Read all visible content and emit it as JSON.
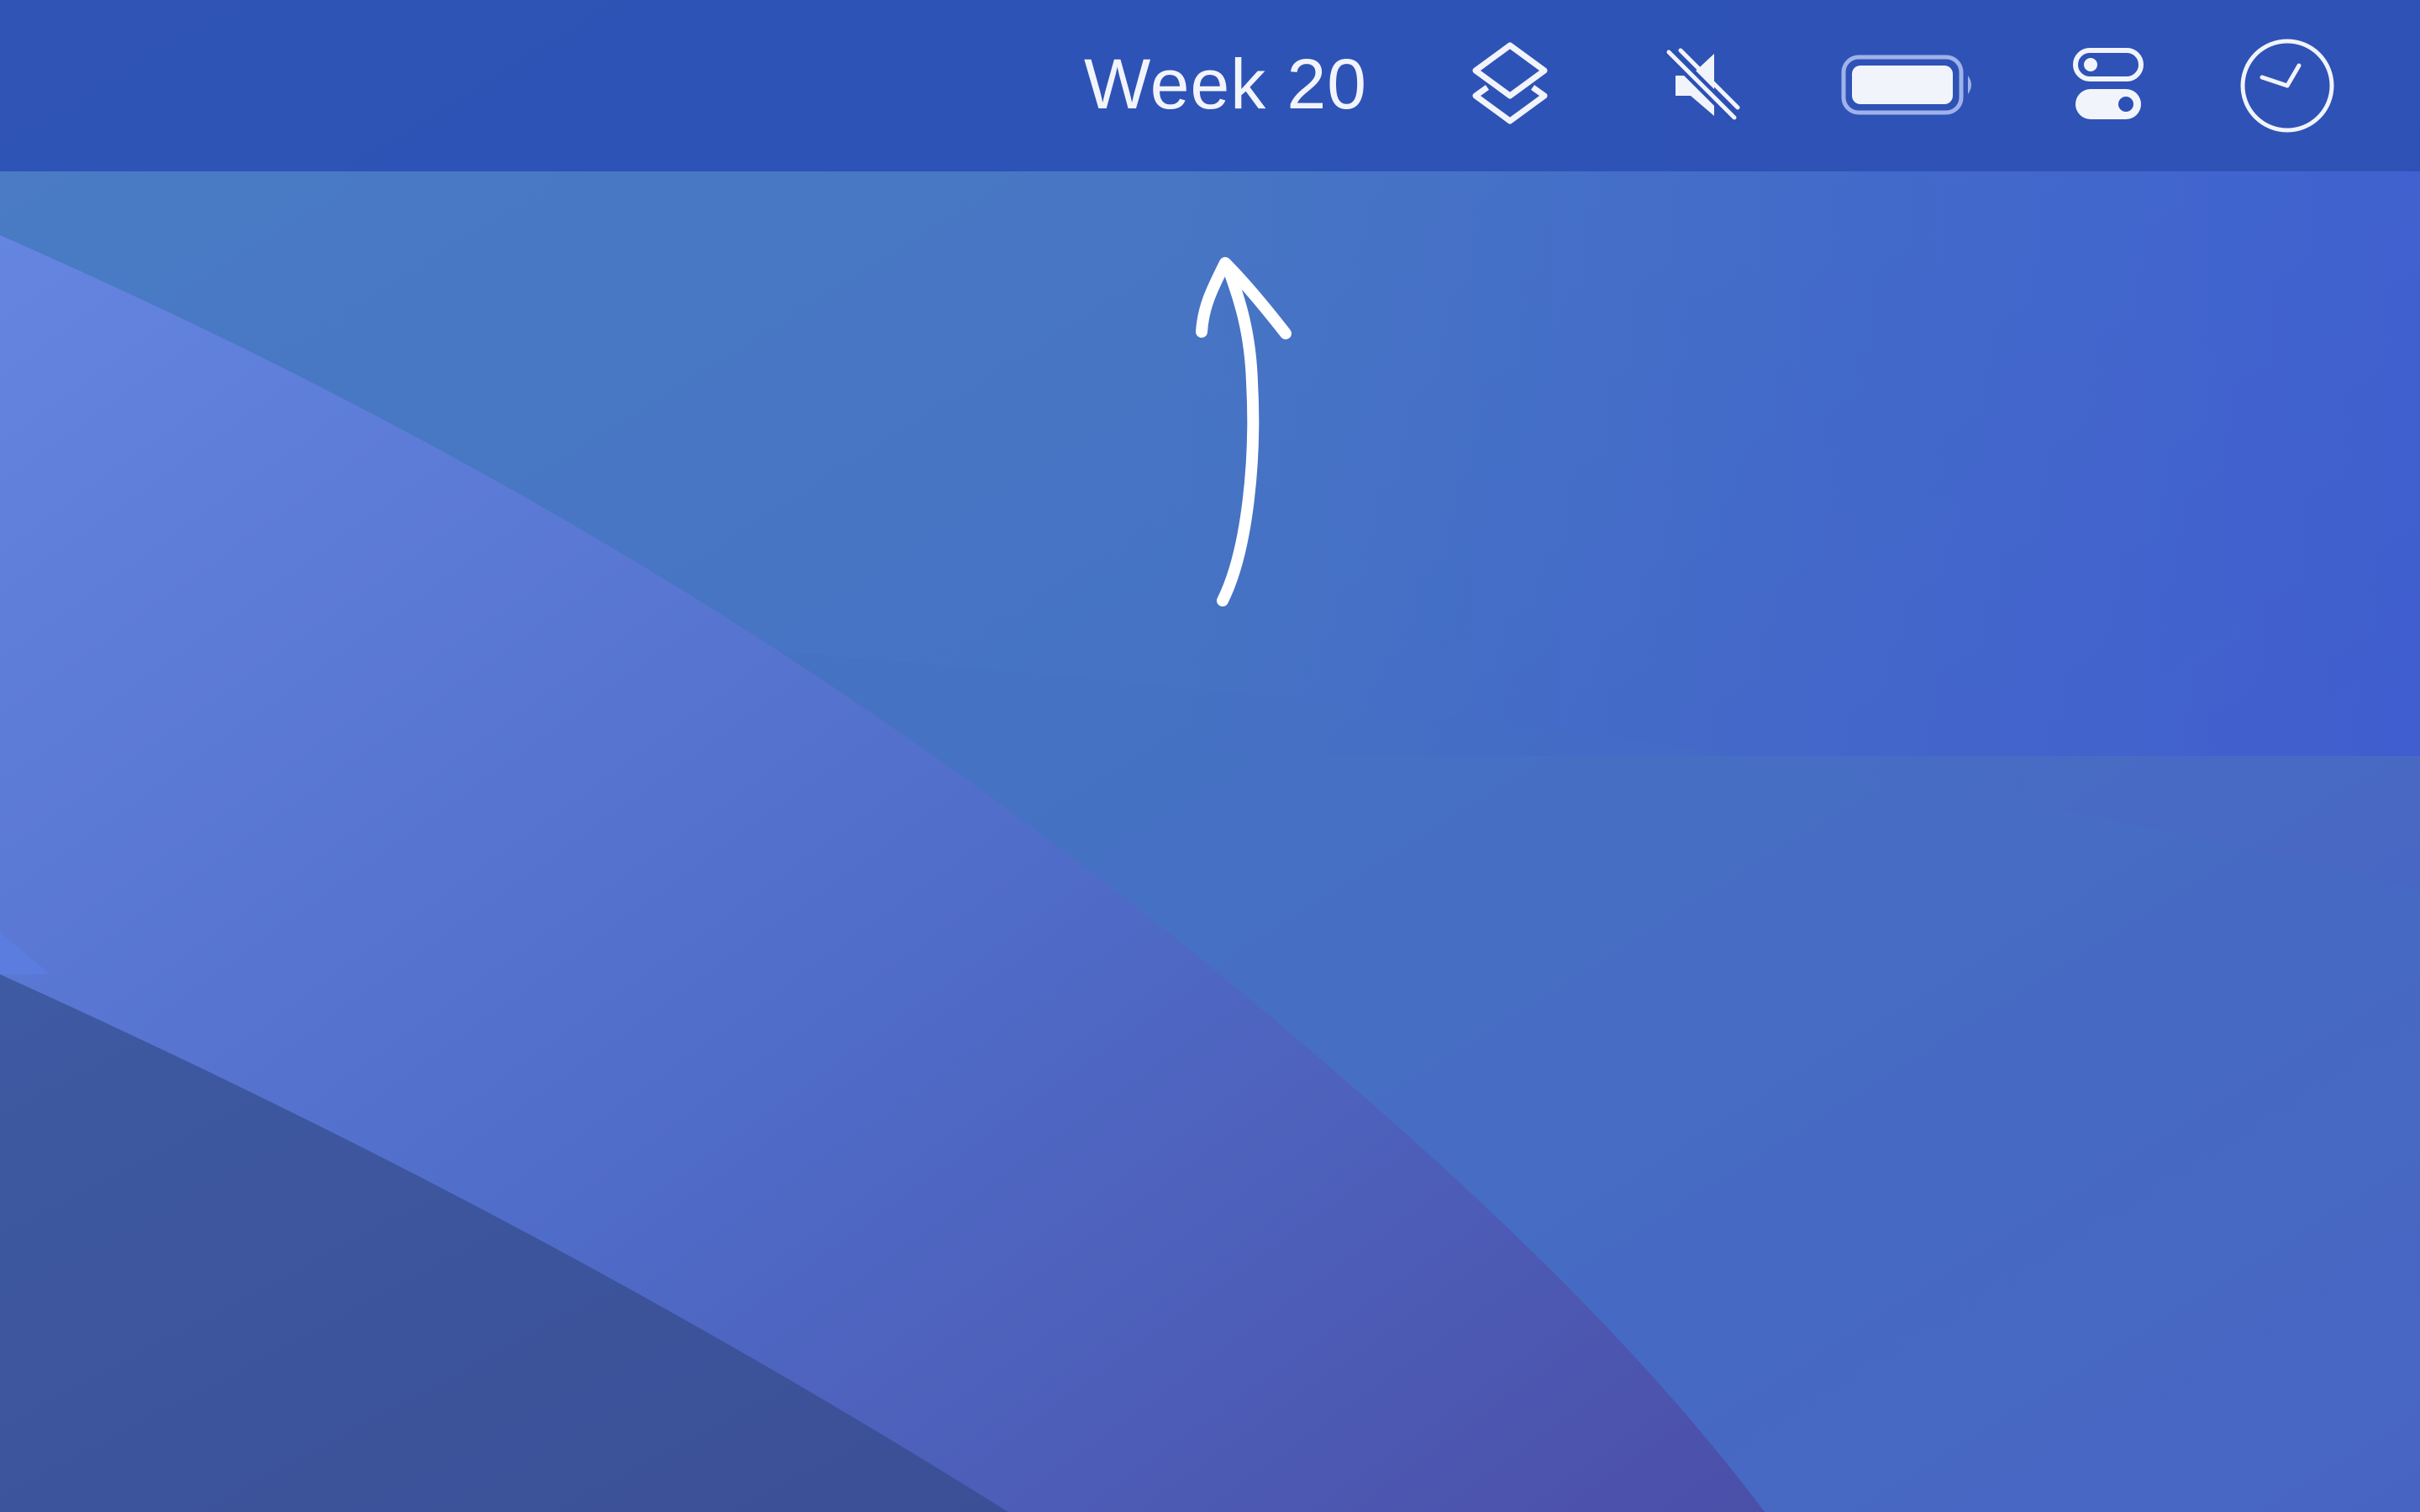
{
  "menubar": {
    "week_label": "Week 20",
    "icons": [
      {
        "name": "shortcuts-icon"
      },
      {
        "name": "volume-muted-icon"
      },
      {
        "name": "battery-icon"
      },
      {
        "name": "control-center-icon"
      },
      {
        "name": "clock-icon"
      }
    ]
  },
  "colors": {
    "menubar_bg": "#2c50b4",
    "wallpaper_base": "#4678c6",
    "wallpaper_light_wave": "#5a7ede",
    "wallpaper_dark_wave": "#3a4f98",
    "glyph": "#f2f4fb"
  }
}
